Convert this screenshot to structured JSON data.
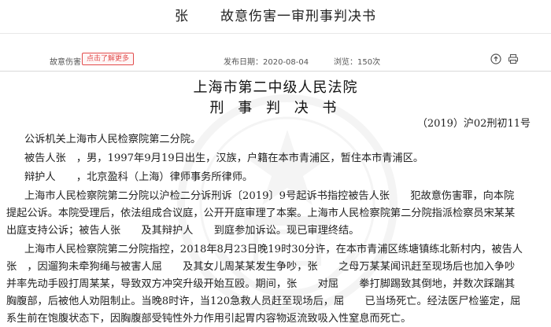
{
  "header": {
    "title_name": "张",
    "title_rest": "故意伤害一审刑事判决书"
  },
  "meta": {
    "case_name": "故意伤害",
    "tag": "点击了解更多",
    "published": "发布日期：2020-08-04",
    "views": "浏览：150次",
    "icons": [
      "share-icon",
      "print-icon"
    ]
  },
  "document": {
    "court": "上海市第二中级人民法院",
    "type": "刑 事 判 决 书",
    "case_no": "（2019）沪02刑初11号",
    "lines": [
      "公诉机关上海市人民检察院第二分院。",
      "被告人张　，男，1997年9月19日出生，汉族，户籍在本市青浦区，暂住本市青浦区。",
      "辩护人　　，北京盈科（上海）律师事务所律师。",
      "上海市人民检察院第二分院以沪检二分诉刑诉〔2019〕9号起诉书指控被告人张　　犯故意伤害罪，向本院",
      "提起公诉。本院受理后，依法组成合议庭，公开开庭审理了本案。上海市人民检察院第二分院指派检察员宋某某",
      "出庭支持公诉；被告人张　　及其辩护人　　到庭参加诉讼。现已审理终结。",
      "上海市人民检察院第二分院指控，2018年8月23日晚19时30分许，在本市青浦区练塘镇练北新村内，被告人",
      "张　，因遛狗未牵狗绳与被害人屈　　及其女儿周某某发生争吵，张　　之母万某某闻讯赶至现场后也加入争吵",
      "并率先动手殴打周某某，导致双方冲突升级开始互殴。期间，张　　对屈　　拳打脚踢致其倒地，并数次踩踹其",
      "胸腹部，后被他人劝阻制止。当晚8时许，当120急救人员赶至现场后，屈　　已当场死亡。经法医尸检鉴定，屈",
      "系生前在饱腹状态下，因胸腹部受钝性外力作用引起胃内容物返流致吸入性窒息而死亡。"
    ]
  },
  "colors": {
    "accent": "#e24c4c",
    "text": "#222222",
    "watermark": "#b0b0b0"
  }
}
